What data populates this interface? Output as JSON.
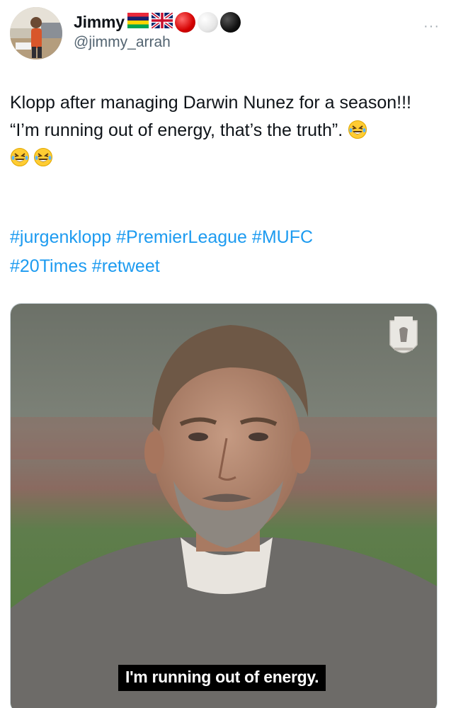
{
  "author": {
    "display_name": "Jimmy",
    "handle": "@jimmy_arrah",
    "avatar_icon": "profile-photo",
    "badges": [
      "mauritius-flag-icon",
      "uk-flag-icon",
      "red-circle-icon",
      "white-circle-icon",
      "black-circle-icon"
    ]
  },
  "more_button": {
    "icon": "ellipsis-icon",
    "label": "···"
  },
  "tweet": {
    "line1": "Klopp after managing Darwin Nunez for a season!!!",
    "line2": "“I’m running out of energy, that’s the truth”.",
    "emoji_icon": "rolling-on-floor-laughing-icon",
    "hashtags": [
      "#jurgenklopp",
      "#PremierLeague",
      "#MUFC",
      "#20Times",
      "#retweet"
    ]
  },
  "media": {
    "subtitle": "I'm running out of energy.",
    "crest_icon": "liverpool-crest-icon"
  },
  "colors": {
    "link": "#1d9bf0",
    "handle": "#536471",
    "text": "#0f1419"
  }
}
